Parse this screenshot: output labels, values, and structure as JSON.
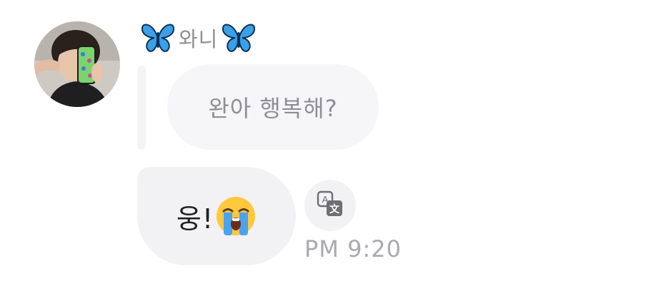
{
  "sender": {
    "name": "와니",
    "decoration_icon": "blue-butterfly-icon"
  },
  "reply": {
    "quoted_text": "완아 행복해?"
  },
  "message": {
    "text": "웅!",
    "emoji": "loudly-crying-face-icon"
  },
  "translate": {
    "icon": "translate-icon"
  },
  "timestamp": "PM 9:20",
  "colors": {
    "bubble": "#f2f2f5",
    "quoted_bubble": "#f6f6f9",
    "secondary_text": "#8e8e93",
    "time_text": "#a9a9b0",
    "butterfly": "#3aa0e8"
  }
}
